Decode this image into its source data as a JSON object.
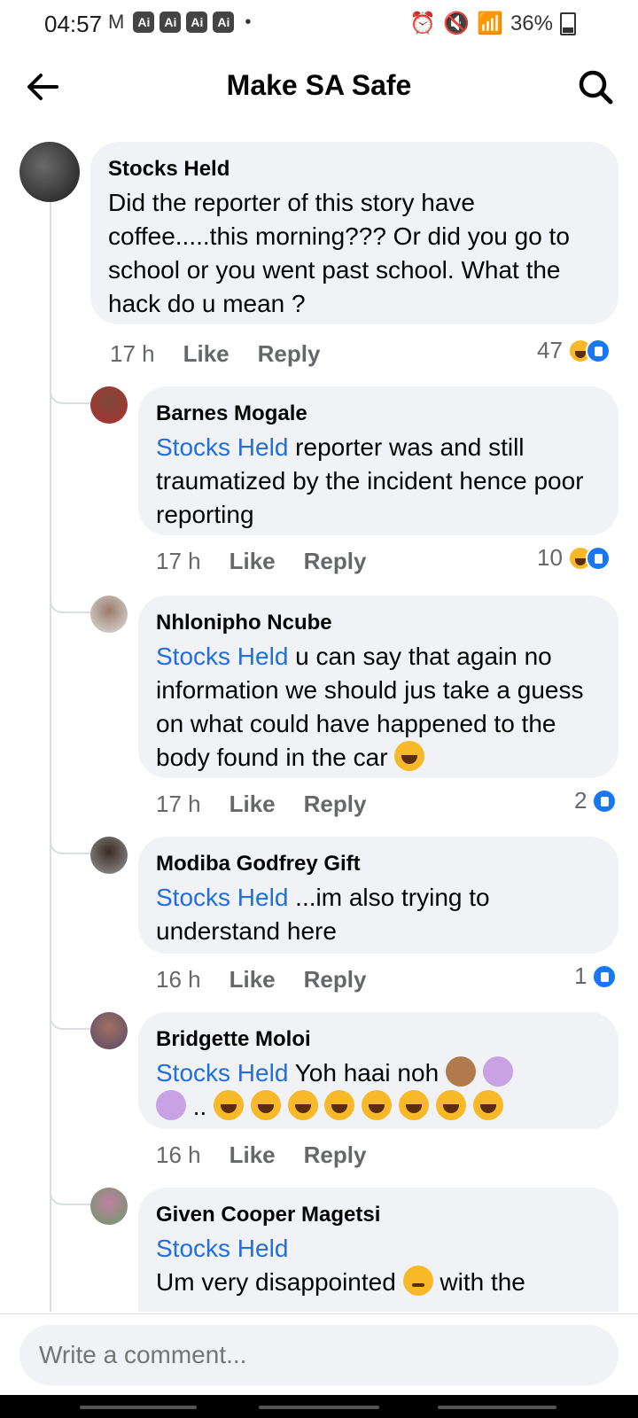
{
  "status_bar": {
    "time": "04:57",
    "battery": "36%",
    "ai_badge": "Ai"
  },
  "header": {
    "title": "Make SA Safe"
  },
  "comments": [
    {
      "author": "Stocks Held",
      "text": "Did the reporter of this story have coffee.....this morning??? Or did you go to school or you went past school. What the hack do u mean ?",
      "time": "17 h",
      "like_label": "Like",
      "reply_label": "Reply",
      "reaction_count": "47",
      "reactions": [
        "haha-icon",
        "like-icon"
      ]
    },
    {
      "author": "Barnes Mogale",
      "mention": "Stocks Held",
      "text": " reporter was and still traumatized by the incident hence poor reporting",
      "time": "17 h",
      "like_label": "Like",
      "reply_label": "Reply",
      "reaction_count": "10",
      "reactions": [
        "haha-icon",
        "like-icon"
      ]
    },
    {
      "author": "Nhlonipho Ncube",
      "mention": "Stocks Held",
      "text": " u can say that again no information we should jus take a guess on what could have happened to the body found in the car",
      "time": "17 h",
      "like_label": "Like",
      "reply_label": "Reply",
      "reaction_count": "2",
      "reactions": [
        "like-icon"
      ]
    },
    {
      "author": "Modiba Godfrey Gift",
      "mention": "Stocks Held",
      "text": " ...im also trying to understand here",
      "time": "16 h",
      "like_label": "Like",
      "reply_label": "Reply",
      "reaction_count": "1",
      "reactions": [
        "like-icon"
      ]
    },
    {
      "author": "Bridgette Moloi",
      "mention": "Stocks Held",
      "text": " Yoh haai noh",
      "text2": " ..",
      "time": "16 h",
      "like_label": "Like",
      "reply_label": "Reply"
    },
    {
      "author": "Given Cooper Magetsi",
      "mention": "Stocks Held",
      "text": "Um very disappointed",
      "text2": " with the"
    }
  ],
  "composer": {
    "placeholder": "Write a comment..."
  }
}
